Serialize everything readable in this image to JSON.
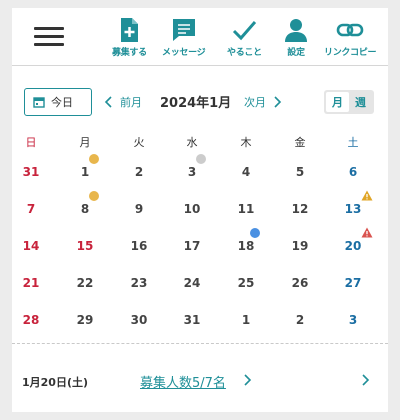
{
  "header": {
    "nav": [
      {
        "label": "募集する",
        "icon": "file-plus-icon"
      },
      {
        "label": "メッセージ",
        "icon": "chat-message-icon"
      },
      {
        "label": "やること",
        "icon": "checkmark-icon"
      },
      {
        "label": "設定",
        "icon": "user-icon"
      },
      {
        "label": "リンクコピー",
        "icon": "link-icon"
      }
    ]
  },
  "toolbar": {
    "today_label": "今日",
    "prev_label": "前月",
    "month_title": "2024年1月",
    "next_label": "次月",
    "view_month": "月",
    "view_week": "週",
    "active_view": "月"
  },
  "weekdays": [
    "日",
    "月",
    "火",
    "水",
    "木",
    "金",
    "土"
  ],
  "weeks": [
    [
      {
        "d": "31"
      },
      {
        "d": "1",
        "dot": "#e8b64c"
      },
      {
        "d": "2"
      },
      {
        "d": "3",
        "dot": "#cccccc"
      },
      {
        "d": "4"
      },
      {
        "d": "5"
      },
      {
        "d": "6"
      }
    ],
    [
      {
        "d": "7"
      },
      {
        "d": "8",
        "dot": "#e8b64c"
      },
      {
        "d": "9"
      },
      {
        "d": "10"
      },
      {
        "d": "11"
      },
      {
        "d": "12"
      },
      {
        "d": "13",
        "warn": "#e0a526"
      }
    ],
    [
      {
        "d": "14"
      },
      {
        "d": "15",
        "holiday": true
      },
      {
        "d": "16"
      },
      {
        "d": "17"
      },
      {
        "d": "18",
        "dot": "#4a90e2"
      },
      {
        "d": "19"
      },
      {
        "d": "20",
        "warn": "#d9534f"
      }
    ],
    [
      {
        "d": "21"
      },
      {
        "d": "22"
      },
      {
        "d": "23"
      },
      {
        "d": "24"
      },
      {
        "d": "25"
      },
      {
        "d": "26"
      },
      {
        "d": "27"
      }
    ],
    [
      {
        "d": "28"
      },
      {
        "d": "29"
      },
      {
        "d": "30"
      },
      {
        "d": "31"
      },
      {
        "d": "1"
      },
      {
        "d": "2"
      },
      {
        "d": "3"
      }
    ]
  ],
  "footer": {
    "selected_date": "1月20日(土)",
    "recruit_link": "募集人数5/7名"
  },
  "colors": {
    "accent": "#1f8f98",
    "sunday": "#c8233c",
    "saturday": "#1b6ea3"
  }
}
